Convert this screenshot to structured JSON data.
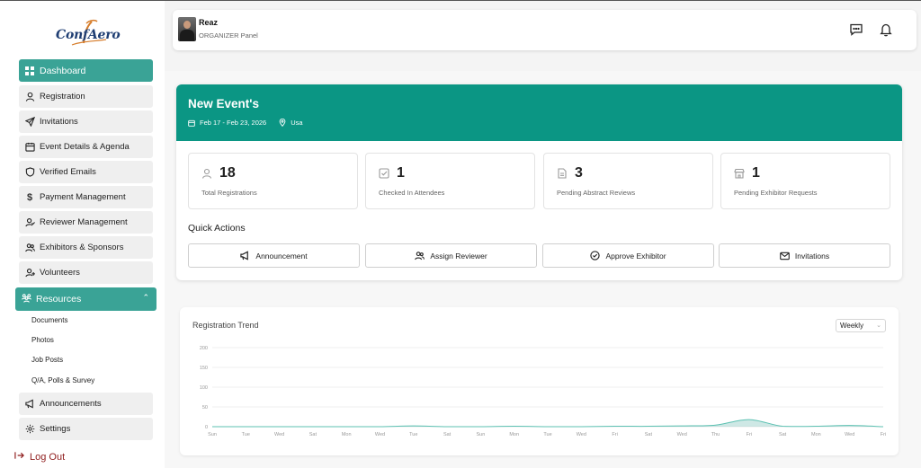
{
  "app": {
    "logo_text": "ConfAero"
  },
  "sidebar": {
    "items": [
      {
        "label": "Dashboard",
        "icon": "dashboard-icon"
      },
      {
        "label": "Registration",
        "icon": "user-icon"
      },
      {
        "label": "Invitations",
        "icon": "send-icon"
      },
      {
        "label": "Event Details & Agenda",
        "icon": "calendar-icon"
      },
      {
        "label": "Verified Emails",
        "icon": "shield-icon"
      },
      {
        "label": "Payment Management",
        "icon": "dollar-icon"
      },
      {
        "label": "Reviewer Management",
        "icon": "user-check-icon"
      },
      {
        "label": "Exhibitors & Sponsors",
        "icon": "users-icon"
      },
      {
        "label": "Volunteers",
        "icon": "user-plus-icon"
      }
    ],
    "resources": {
      "label": "Resources",
      "sub_items": [
        "Documents",
        "Photos",
        "Job Posts",
        "Q/A, Polls & Survey"
      ]
    },
    "bottom_items": [
      {
        "label": "Announcements",
        "icon": "megaphone-icon"
      },
      {
        "label": "Settings",
        "icon": "gear-icon"
      }
    ],
    "logout": "Log Out"
  },
  "header": {
    "user_name": "Reaz",
    "user_role": "ORGANIZER Panel"
  },
  "event": {
    "title": "New Event's",
    "dates": "Feb 17 - Feb 23, 2026",
    "location": "Usa"
  },
  "stats": [
    {
      "value": "18",
      "label": "Total Registrations"
    },
    {
      "value": "1",
      "label": "Checked In Attendees"
    },
    {
      "value": "3",
      "label": "Pending Abstract Reviews"
    },
    {
      "value": "1",
      "label": "Pending Exhibitor Requests"
    }
  ],
  "quick_actions": {
    "title": "Quick Actions",
    "buttons": [
      "Announcement",
      "Assign Reviewer",
      "Approve Exhibitor",
      "Invitations"
    ]
  },
  "trend": {
    "title": "Registration Trend",
    "period": "Weekly"
  },
  "colors": {
    "accent": "#3aa396",
    "header": "#0b9684",
    "logout": "#8f1d1d"
  },
  "chart_data": {
    "type": "area",
    "x": [
      "Sun",
      "Tue",
      "Wed",
      "Sat",
      "Mon",
      "Wed",
      "Tue",
      "Sat",
      "Sun",
      "Mon",
      "Tue",
      "Wed",
      "Fri",
      "Sat",
      "Wed",
      "Thu",
      "Fri",
      "Sat",
      "Mon",
      "Wed",
      "Fri"
    ],
    "series": [
      {
        "values": [
          0,
          0,
          0,
          0,
          0,
          0,
          2,
          0,
          0,
          1,
          0,
          0,
          1,
          1,
          2,
          4,
          18,
          1,
          1,
          3,
          0
        ]
      }
    ],
    "yticks": [
      0,
      50,
      100,
      150,
      200
    ],
    "ylim": [
      0,
      200
    ],
    "grid": true
  }
}
